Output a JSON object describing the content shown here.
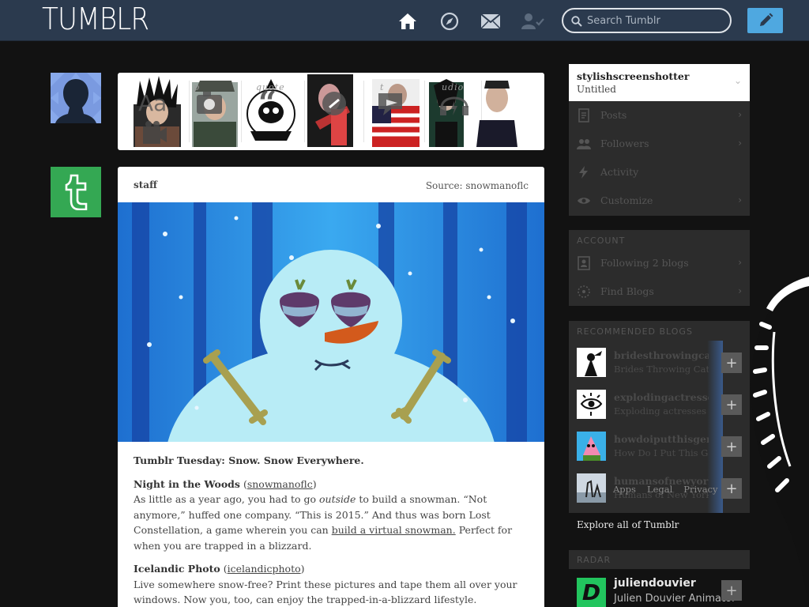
{
  "header": {
    "logo": "TUMBLR",
    "search_placeholder": "Search Tumblr",
    "icons": [
      "home-icon",
      "compass-icon",
      "mail-icon",
      "person-check-icon",
      "pencil-icon"
    ]
  },
  "post_types": {
    "labels": [
      "p",
      "quote",
      "",
      "t",
      "udio",
      ""
    ],
    "icons": [
      "text-icon",
      "photo-icon",
      "quote-icon",
      "link-icon",
      "chat-icon",
      "audio-icon",
      "video-icon"
    ]
  },
  "post": {
    "author": "staff",
    "source": "Source: snowmanoflc",
    "title": "Tumblr Tuesday: Snow. Snow Everywhere.",
    "sections": [
      {
        "heading": "Night in the Woods",
        "link": "snowmanoflc",
        "text_a": "As little as a year ago, you had to go ",
        "text_em": "outside",
        "text_b": " to build a snowman. “Not anymore,” huffed one company. “This is 2015.” And thus was born Lost Constellation, a game wherein you can ",
        "inline_link": "build a virtual snowman.",
        "text_c": " Perfect for when you are trapped in a blizzard."
      },
      {
        "heading": "Icelandic Photo",
        "link": "icelandicphoto",
        "text": "Live somewhere snow-free? Print these pictures and tape them all over your windows. Now you, too, can enjoy the trapped-in-a-blizzard lifestyle."
      }
    ]
  },
  "sidebar": {
    "blog_name": "stylishscreenshotter",
    "blog_title": "Untitled",
    "blog_items": [
      {
        "label": "Posts",
        "icon": "posts-icon"
      },
      {
        "label": "Followers",
        "icon": "followers-icon"
      },
      {
        "label": "Activity",
        "icon": "activity-icon"
      },
      {
        "label": "Customize",
        "icon": "eye-icon"
      }
    ],
    "account_title": "ACCOUNT",
    "account_items": [
      {
        "label": "Following 2 blogs",
        "icon": "following-icon"
      },
      {
        "label": "Find Blogs",
        "icon": "find-blogs-icon"
      }
    ],
    "recommended_title": "RECOMMENDED BLOGS",
    "recommended": [
      {
        "name": "bridesthrowingcats",
        "title": "Brides Throwing Cats"
      },
      {
        "name": "explodingactresses",
        "title": "Exploding actresses"
      },
      {
        "name": "howdoiputthisgently",
        "title": "How Do I Put This Gently"
      },
      {
        "name": "humansofnewyork",
        "title": "Humans of New York"
      }
    ],
    "explore": "Explore all of Tumblr",
    "footer_links": [
      "Apps",
      "Legal",
      "Privacy"
    ],
    "radar_title": "RADAR",
    "radar": {
      "name": "juliendouvier",
      "title": "Julien Douvier Animator",
      "logo": "D"
    }
  },
  "colors": {
    "header_bg": "#2b3a4e",
    "body_bg": "#121212",
    "compose_blue": "#4fa8e0",
    "staff_green": "#34a853"
  }
}
